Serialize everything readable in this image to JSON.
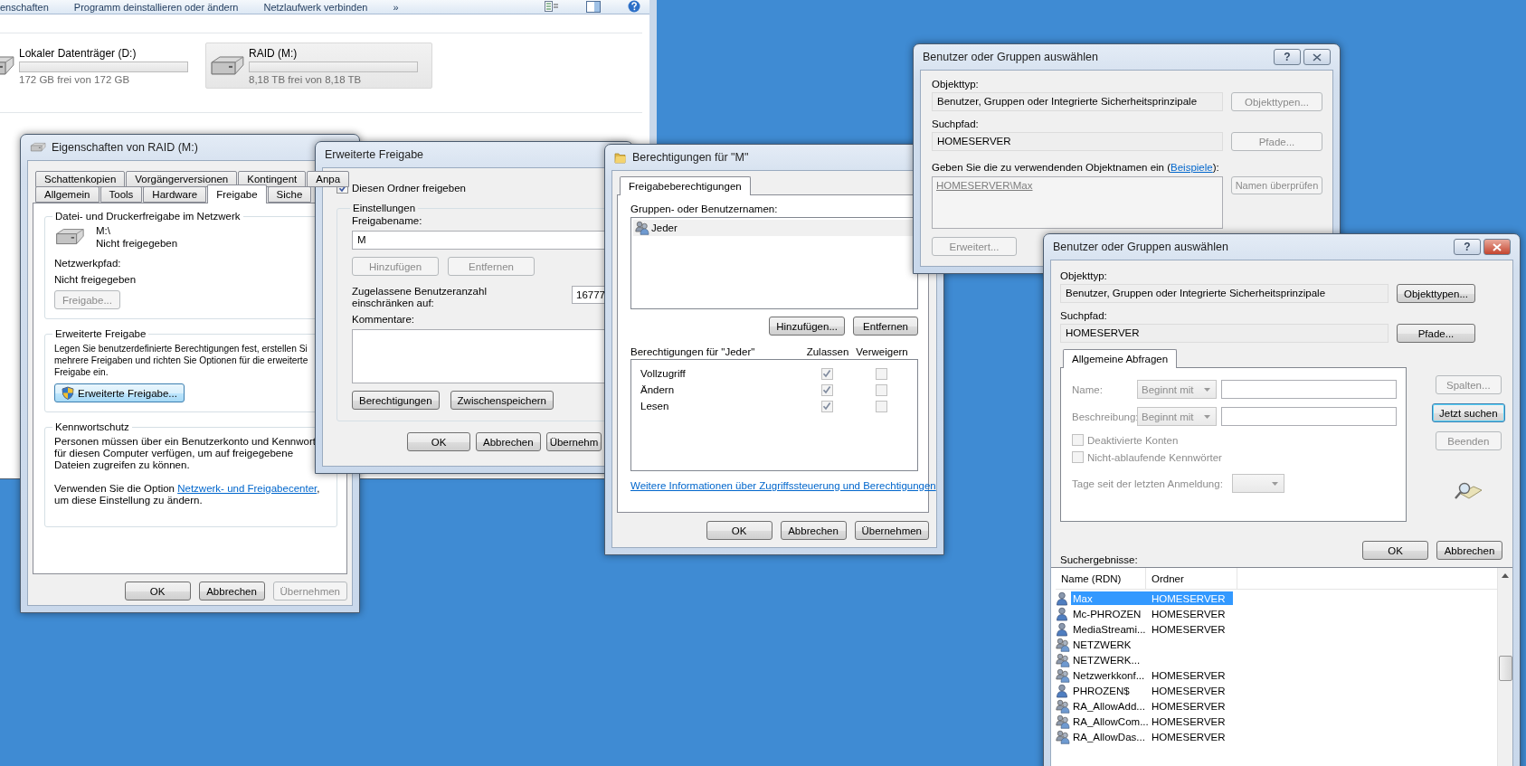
{
  "explorer": {
    "toolbar": [
      {
        "label": "enschaften"
      },
      {
        "label": "Programm deinstallieren oder ändern"
      },
      {
        "label": "Netzlaufwerk verbinden"
      },
      {
        "label": "»"
      }
    ],
    "drives": [
      {
        "name": "Lokaler Datenträger (D:)",
        "free": "172 GB frei von 172 GB",
        "level": 0,
        "selected": false
      },
      {
        "name": "RAID (M:)",
        "free": "8,18 TB frei von 8,18 TB",
        "level": 0,
        "selected": true
      }
    ]
  },
  "properties": {
    "title": "Eigenschaften von RAID (M:)",
    "tab_rows": [
      [
        {
          "label": "Schattenkopien",
          "selected": false
        },
        {
          "label": "Vorgängerversionen",
          "selected": false
        },
        {
          "label": "Kontingent",
          "selected": false
        },
        {
          "label": "Anpa",
          "selected": false
        }
      ],
      [
        {
          "label": "Allgemein",
          "selected": false
        },
        {
          "label": "Tools",
          "selected": false
        },
        {
          "label": "Hardware",
          "selected": false
        },
        {
          "label": "Freigabe",
          "selected": true
        },
        {
          "label": "Siche",
          "selected": false
        }
      ]
    ],
    "network_sharing": {
      "heading": "Datei- und Druckerfreigabe im Netzwerk",
      "drive": "M:\\",
      "status": "Nicht freigegeben",
      "path_label": "Netzwerkpfad:",
      "path": "Nicht freigegeben",
      "button": {
        "label": "Freigabe...",
        "disabled": true
      }
    },
    "advanced": {
      "heading": "Erweiterte Freigabe",
      "lines": [
        "Legen Sie benutzerdefinierte Berechtigungen fest, erstellen Si",
        "mehrere Freigaben und richten Sie Optionen für die erweiterte",
        "Freigabe ein."
      ],
      "button": {
        "label": "Erweiterte Freigabe...",
        "hovered": true
      }
    },
    "password": {
      "heading": "Kennwortschutz",
      "text": "Personen müssen über ein Benutzerkonto und Kennwort für diesen Computer verfügen, um auf freigegebene Dateien zugreifen zu können.",
      "option_before": "Verwenden Sie die Option ",
      "link": "Netzwerk- und Freigabecenter",
      "option_after": ", um diese Einstellung zu ändern."
    },
    "buttons": [
      {
        "label": "OK",
        "disabled": false
      },
      {
        "label": "Abbrechen",
        "disabled": false
      },
      {
        "label": "Übernehmen",
        "disabled": true
      }
    ]
  },
  "advanced_sharing": {
    "title": "Erweiterte Freigabe",
    "share_checkbox": {
      "label": "Diesen Ordner freigeben",
      "checked": true
    },
    "settings": {
      "heading": "Einstellungen",
      "name_label": "Freigabename:",
      "name_value": "M",
      "name_buttons": [
        {
          "label": "Hinzufügen",
          "disabled": true
        },
        {
          "label": "Entfernen",
          "disabled": true
        }
      ],
      "limit_label": "Zugelassene Benutzeranzahl einschränken auf:",
      "limit_value": "16777",
      "comments_label": "Kommentare:",
      "buttons": [
        {
          "label": "Berechtigungen",
          "disabled": false
        },
        {
          "label": "Zwischenspeichern",
          "disabled": false
        }
      ]
    },
    "buttons": [
      {
        "label": "OK",
        "disabled": false
      },
      {
        "label": "Abbrechen",
        "disabled": false
      },
      {
        "label": "Übernehm",
        "disabled": false
      }
    ]
  },
  "permissions": {
    "title": "Berechtigungen für \"M\"",
    "tabs": [
      {
        "label": "Freigabeberechtigungen",
        "selected": true
      }
    ],
    "groups_label": "Gruppen- oder Benutzernamen:",
    "groups": [
      {
        "name": "Jeder",
        "selected": true
      }
    ],
    "group_buttons": [
      {
        "label": "Hinzufügen...",
        "disabled": false
      },
      {
        "label": "Entfernen",
        "disabled": false
      }
    ],
    "permissions_label": "Berechtigungen für \"Jeder\"",
    "columns": [
      "Zulassen",
      "Verweigern"
    ],
    "entries": [
      {
        "name": "Vollzugriff",
        "allow": true,
        "deny": false
      },
      {
        "name": "Ändern",
        "allow": true,
        "deny": false
      },
      {
        "name": "Lesen",
        "allow": true,
        "deny": false
      }
    ],
    "link": "Weitere Informationen über Zugriffssteuerung und Berechtigungen",
    "buttons": [
      {
        "label": "OK",
        "disabled": false
      },
      {
        "label": "Abbrechen",
        "disabled": false
      },
      {
        "label": "Übernehmen",
        "disabled": false
      }
    ]
  },
  "select_back": {
    "title": "Benutzer oder Gruppen auswählen",
    "active": false,
    "help": "?",
    "object_type_label": "Objekttyp:",
    "object_type": "Benutzer, Gruppen oder Integrierte Sicherheitsprinzipale",
    "object_type_button": {
      "label": "Objekttypen...",
      "disabled": true
    },
    "path_label": "Suchpfad:",
    "path": "HOMESERVER",
    "path_button": {
      "label": "Pfade...",
      "disabled": true
    },
    "names_before": "Geben Sie die zu verwendenden Objektnamen ein (",
    "names_link": "Beispiele",
    "names_after": "):",
    "names_value": "HOMESERVER\\Max",
    "check_button": {
      "label": "Namen überprüfen",
      "disabled": true
    },
    "advanced_button": {
      "label": "Erweitert...",
      "disabled": true
    }
  },
  "select_front": {
    "title": "Benutzer oder Gruppen auswählen",
    "active": true,
    "help": "?",
    "object_type_label": "Objekttyp:",
    "object_type": "Benutzer, Gruppen oder Integrierte Sicherheitsprinzipale",
    "object_type_button": {
      "label": "Objekttypen...",
      "disabled": false
    },
    "path_label": "Suchpfad:",
    "path": "HOMESERVER",
    "path_button": {
      "label": "Pfade...",
      "disabled": false
    },
    "query": {
      "tab": {
        "label": "Allgemeine Abfragen",
        "selected": true
      },
      "disabled": true,
      "fields": [
        {
          "label": "Name:",
          "mode": "Beginnt mit"
        },
        {
          "label": "Beschreibung:",
          "mode": "Beginnt mit"
        }
      ],
      "checkboxes": [
        {
          "label": "Deaktivierte Konten",
          "checked": false
        },
        {
          "label": "Nicht-ablaufende Kennwörter",
          "checked": false
        }
      ],
      "days_label": "Tage seit der letzten Anmeldung:"
    },
    "side_buttons": [
      {
        "label": "Spalten...",
        "disabled": true,
        "default": false
      },
      {
        "label": "Jetzt suchen",
        "disabled": false,
        "default": true
      },
      {
        "label": "Beenden",
        "disabled": true,
        "default": false
      }
    ],
    "buttons": [
      {
        "label": "OK",
        "disabled": false
      },
      {
        "label": "Abbrechen",
        "disabled": false
      }
    ],
    "results_label": "Suchergebnisse:",
    "columns": [
      "Name (RDN)",
      "Ordner"
    ],
    "rows": [
      {
        "name": "Max",
        "folder": "HOMESERVER",
        "kind": "user",
        "selected": true
      },
      {
        "name": "Mc-PHROZEN",
        "folder": "HOMESERVER",
        "kind": "user",
        "selected": false
      },
      {
        "name": "MediaStreami...",
        "folder": "HOMESERVER",
        "kind": "user",
        "selected": false
      },
      {
        "name": "NETZWERK",
        "kind": "group",
        "selected": false
      },
      {
        "name": "NETZWERK...",
        "kind": "group",
        "selected": false
      },
      {
        "name": "Netzwerkkonf...",
        "folder": "HOMESERVER",
        "kind": "group",
        "selected": false
      },
      {
        "name": "PHROZEN$",
        "folder": "HOMESERVER",
        "kind": "user",
        "selected": false
      },
      {
        "name": "RA_AllowAdd...",
        "folder": "HOMESERVER",
        "kind": "group",
        "selected": false
      },
      {
        "name": "RA_AllowCom...",
        "folder": "HOMESERVER",
        "kind": "group",
        "selected": false
      },
      {
        "name": "RA_AllowDas...",
        "folder": "HOMESERVER",
        "kind": "group",
        "selected": false
      }
    ]
  }
}
